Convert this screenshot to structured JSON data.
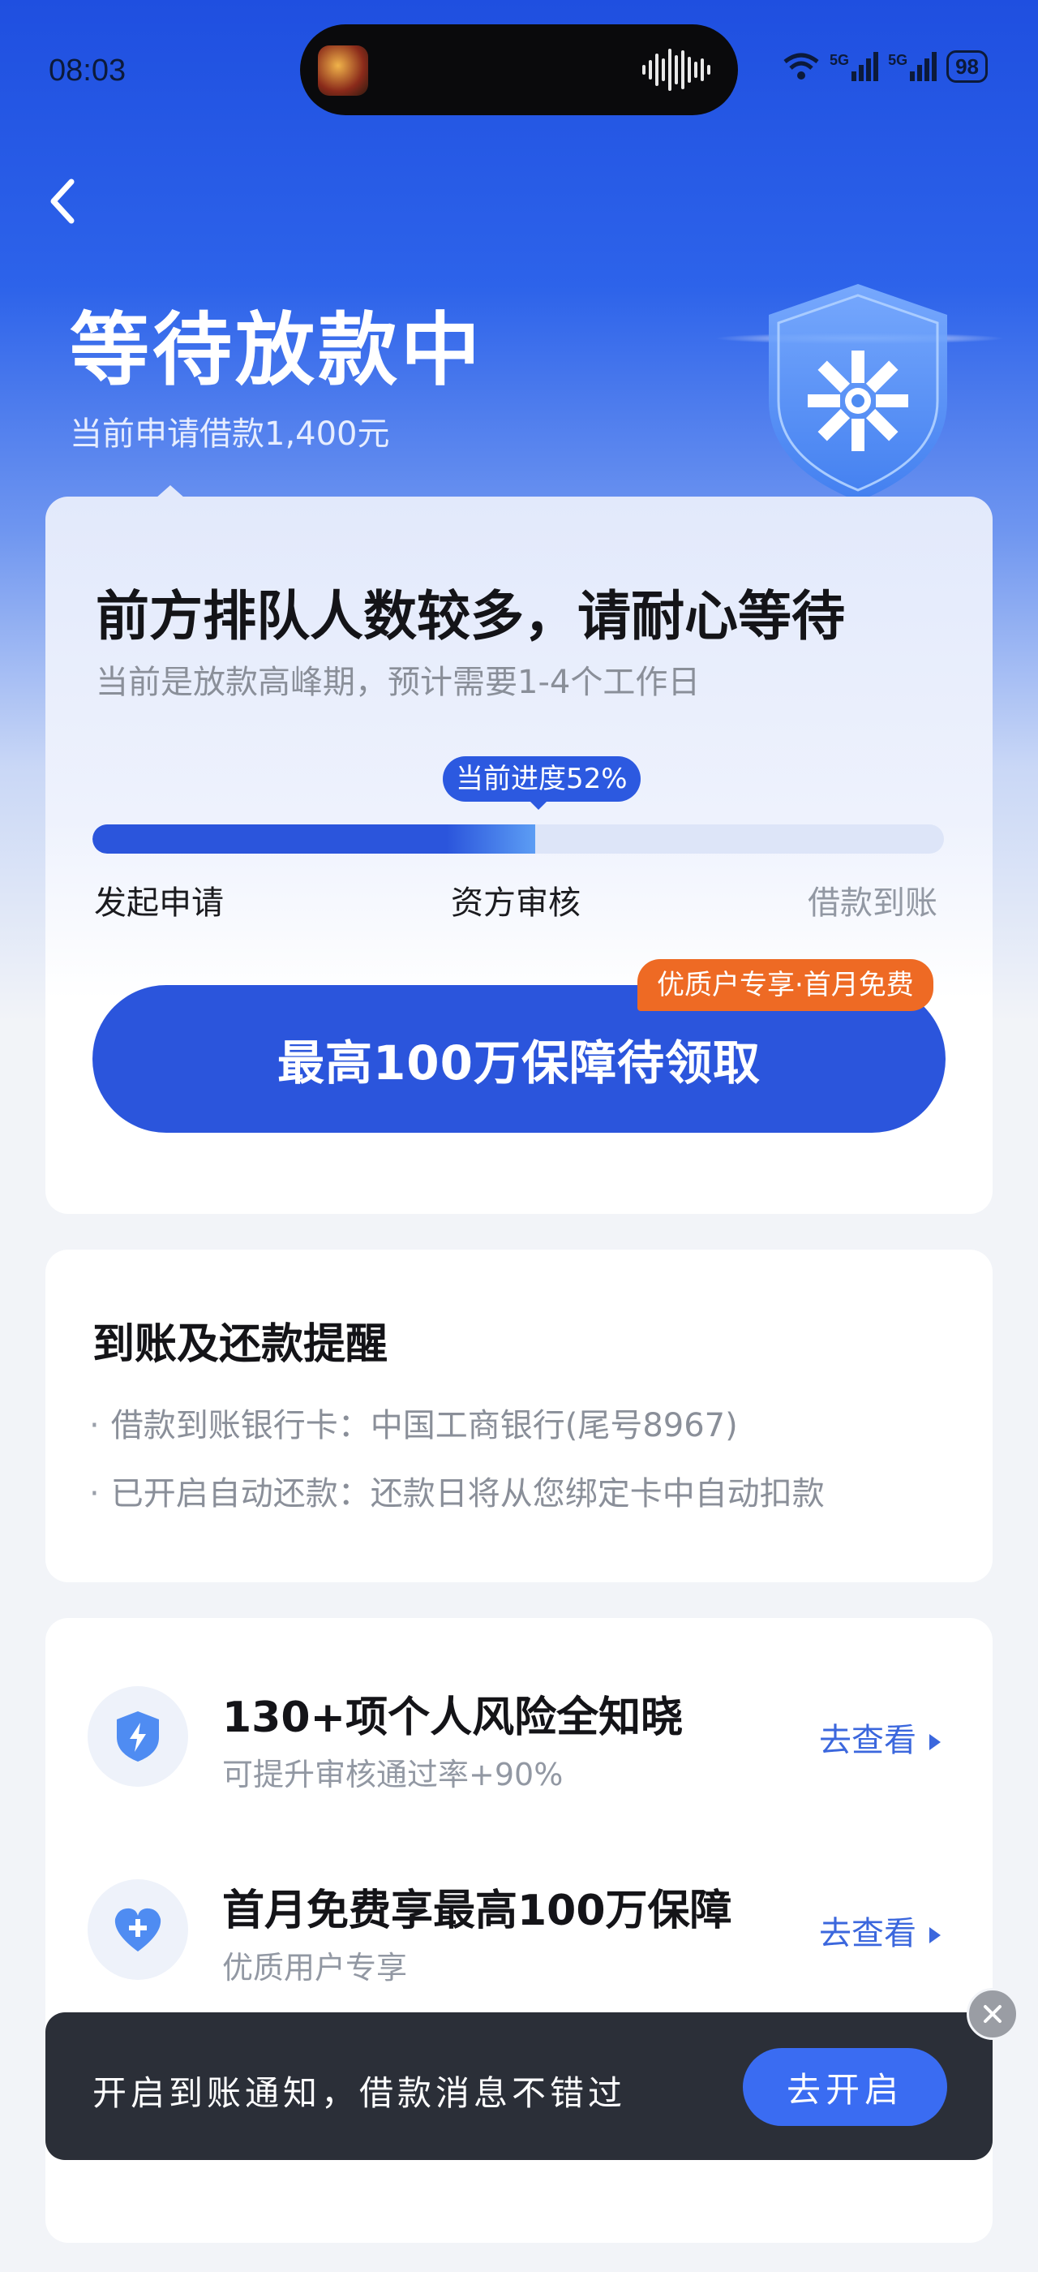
{
  "status_bar": {
    "time": "08:03",
    "network_1": "5G",
    "network_2": "5G",
    "battery": "98"
  },
  "header": {
    "back_icon": "chevron-left-icon",
    "title": "等待放款中",
    "subtitle": "当前申请借款1,400元"
  },
  "progress_card": {
    "title": "前方排队人数较多，请耐心等待",
    "subtitle": "当前是放款高峰期，预计需要1-4个工作日",
    "progress_label": "当前进度52%",
    "progress_value": 0.52,
    "steps": [
      "发起申请",
      "资方审核",
      "借款到账"
    ],
    "cta_label": "最高100万保障待领取",
    "cta_badge": "优质户专享·首月免费",
    "accent_color": "#2b55dc",
    "badge_color": "#ee6a24"
  },
  "reminder_card": {
    "title": "到账及还款提醒",
    "items": [
      "借款到账银行卡：中国工商银行(尾号8967)",
      "已开启自动还款：还款日将从您绑定卡中自动扣款"
    ]
  },
  "services": [
    {
      "icon": "shield-bolt-icon",
      "title": "130+项个人风险全知晓",
      "subtitle": "可提升审核通过率+90%",
      "link": "去查看"
    },
    {
      "icon": "heart-plus-icon",
      "title": "首月免费享最高100万保障",
      "subtitle": "优质用户专享",
      "link": "去查看"
    }
  ],
  "toast": {
    "text": "开启到账通知，借款消息不错过",
    "button": "去开启",
    "close_icon": "close-icon"
  }
}
